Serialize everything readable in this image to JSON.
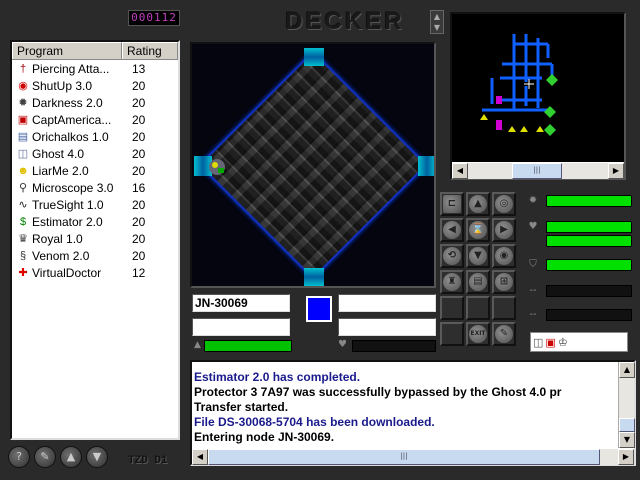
{
  "clock": {
    "time": "000112"
  },
  "logo": {
    "text": "DECKER"
  },
  "programs": {
    "headers": {
      "name": "Program",
      "rating": "Rating"
    },
    "items": [
      {
        "name": "Piercing Atta...",
        "rating": "13",
        "icon": "piercing-icon",
        "glyph": "†",
        "color": "#a00000"
      },
      {
        "name": "ShutUp 3.0",
        "rating": "20",
        "icon": "lips-icon",
        "glyph": "◉",
        "color": "#d00000"
      },
      {
        "name": "Darkness 2.0",
        "rating": "20",
        "icon": "gear-icon",
        "glyph": "✹",
        "color": "#404040"
      },
      {
        "name": "CaptAmerica...",
        "rating": "20",
        "icon": "shield-icon",
        "glyph": "▣",
        "color": "#c00000"
      },
      {
        "name": "Orichalkos 1.0",
        "rating": "20",
        "icon": "box-icon",
        "glyph": "▤",
        "color": "#4060a0"
      },
      {
        "name": "Ghost 4.0",
        "rating": "20",
        "icon": "ghost-icon",
        "glyph": "◫",
        "color": "#6070a0"
      },
      {
        "name": "LiarMe 2.0",
        "rating": "20",
        "icon": "smiley-icon",
        "glyph": "☻",
        "color": "#e0c000"
      },
      {
        "name": "Microscope 3.0",
        "rating": "16",
        "icon": "magnifier-icon",
        "glyph": "⚲",
        "color": "#303030"
      },
      {
        "name": "TrueSight 1.0",
        "rating": "20",
        "icon": "wave-icon",
        "glyph": "∿",
        "color": "#202020"
      },
      {
        "name": "Estimator 2.0",
        "rating": "20",
        "icon": "dollar-icon",
        "glyph": "$",
        "color": "#008000"
      },
      {
        "name": "Royal 1.0",
        "rating": "20",
        "icon": "crown-icon",
        "glyph": "♛",
        "color": "#404040"
      },
      {
        "name": "Venom 2.0",
        "rating": "20",
        "icon": "snake-icon",
        "glyph": "§",
        "color": "#303030"
      },
      {
        "name": "VirtualDoctor",
        "rating": "12",
        "icon": "red-cross-icon",
        "glyph": "✚",
        "color": "#e00000"
      }
    ]
  },
  "node": {
    "name": "JN-30069",
    "field2": "",
    "field3": "",
    "field4": "",
    "ice_color": "#0000ff",
    "health_left": 1.0,
    "health_right": 0.0
  },
  "status": {
    "bars": [
      {
        "icon": "gear-status-icon",
        "glyph": "✹",
        "level": 1.0
      },
      {
        "icon": "heart-status-icon",
        "glyph": "♥",
        "level": 1.0
      },
      {
        "icon": "heart2-status-icon",
        "glyph": "",
        "level": 1.0
      },
      {
        "icon": "shield-status-icon",
        "glyph": "⛉",
        "level": 1.0
      },
      {
        "icon": "blank-status-icon-1",
        "glyph": "--",
        "level": 0.0
      },
      {
        "icon": "blank-status-icon-2",
        "glyph": "--",
        "level": 0.0
      }
    ]
  },
  "controls": {
    "exit_label": "EXIT"
  },
  "log": {
    "messages": [
      {
        "text": "Estimator 2.0 has completed.",
        "color": "#1a1a8c"
      },
      {
        "text": "Protector 3 7A97 was successfully bypassed by the Ghost 4.0 pr",
        "color": "#000000"
      },
      {
        "text": "Transfer started.",
        "color": "#000000"
      },
      {
        "text": "File DS-30068-5704 has been downloaded.",
        "color": "#1a1a8c"
      },
      {
        "text": "Entering node JN-30069.",
        "color": "#000000"
      }
    ]
  },
  "footer": {
    "id_text": "TZD D1"
  }
}
